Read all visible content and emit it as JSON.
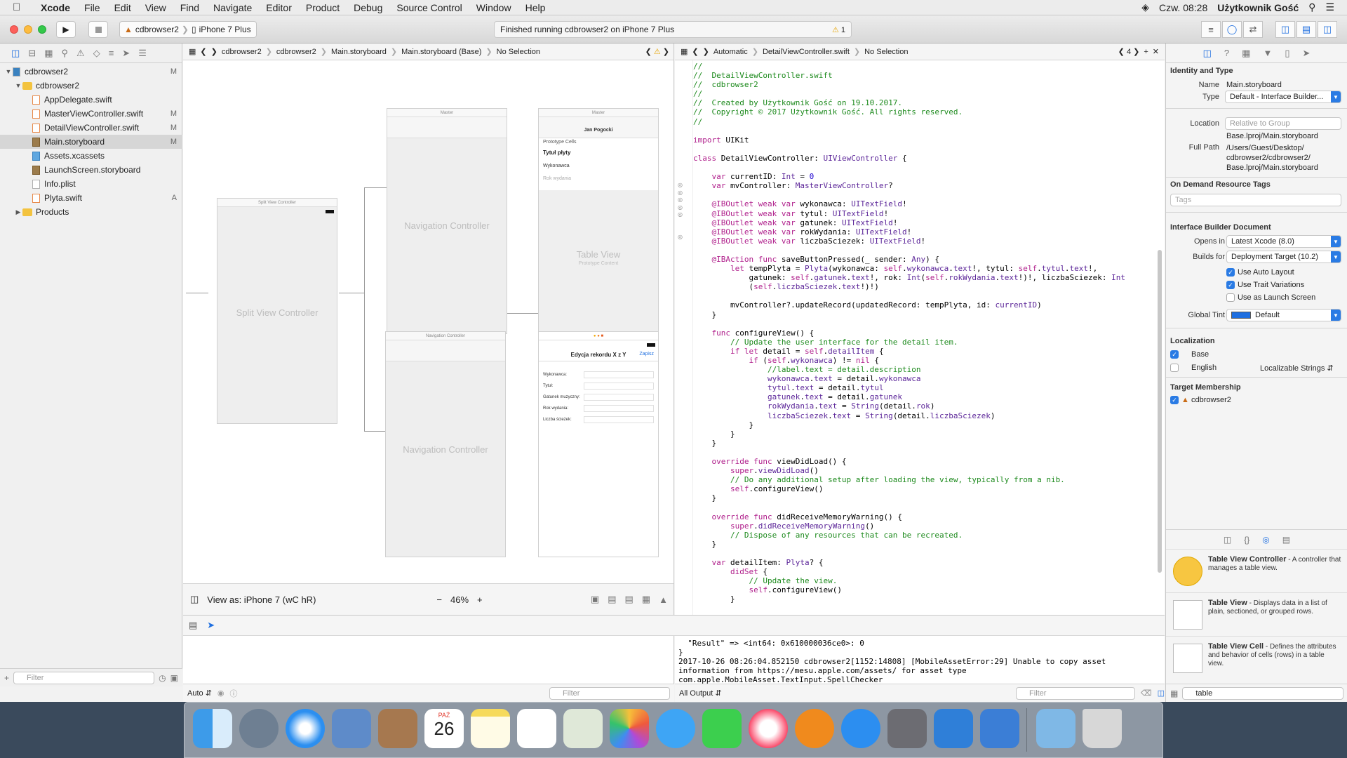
{
  "menubar": {
    "app": "Xcode",
    "items": [
      "File",
      "Edit",
      "View",
      "Find",
      "Navigate",
      "Editor",
      "Product",
      "Debug",
      "Source Control",
      "Window",
      "Help"
    ],
    "clock": "Czw. 08:28",
    "user": "Użytkownik Gość"
  },
  "toolbar": {
    "scheme": "cdbrowser2",
    "device": "iPhone 7 Plus",
    "activity": "Finished running cdbrowser2 on iPhone 7 Plus",
    "warnings": "1"
  },
  "navigator": {
    "rows": [
      {
        "label": "cdbrowser2",
        "badge": "M",
        "kind": "project",
        "indent": 0,
        "open": true
      },
      {
        "label": "cdbrowser2",
        "badge": "",
        "kind": "folder",
        "indent": 1,
        "open": true
      },
      {
        "label": "AppDelegate.swift",
        "badge": "",
        "kind": "swift",
        "indent": 2
      },
      {
        "label": "MasterViewController.swift",
        "badge": "M",
        "kind": "swift",
        "indent": 2
      },
      {
        "label": "DetailViewController.swift",
        "badge": "M",
        "kind": "swift",
        "indent": 2
      },
      {
        "label": "Main.storyboard",
        "badge": "M",
        "kind": "sb",
        "indent": 2,
        "selected": true
      },
      {
        "label": "Assets.xcassets",
        "badge": "",
        "kind": "xc",
        "indent": 2
      },
      {
        "label": "LaunchScreen.storyboard",
        "badge": "",
        "kind": "sb",
        "indent": 2
      },
      {
        "label": "Info.plist",
        "badge": "",
        "kind": "file",
        "indent": 2
      },
      {
        "label": "Plyta.swift",
        "badge": "A",
        "kind": "swift",
        "indent": 2
      },
      {
        "label": "Products",
        "badge": "",
        "kind": "folder",
        "indent": 1,
        "open": false
      }
    ],
    "filter_placeholder": "Filter"
  },
  "ib": {
    "jump": [
      "cdbrowser2",
      "cdbrowser2",
      "Main.storyboard",
      "Main.storyboard (Base)",
      "No Selection"
    ],
    "view_as": "View as: iPhone 7 (wC hR)",
    "zoom": "46%",
    "scenes": {
      "split": "Split View Controller",
      "split_bar": "Split View Controller",
      "nav1": "Navigation Controller",
      "nav1_bar": "Master",
      "table_bar": "Master",
      "table_title": "Jan Pogocki",
      "prototype": "Prototype Cells",
      "cell_title": "Tytuł płyty",
      "cell_sub1": "Wykonawca",
      "cell_sub2": "Rok wydania",
      "table_view": "Table View",
      "prototype_content": "Prototype Content",
      "nav2": "Navigation Controller",
      "nav2_bar": "Navigation Controller",
      "detail_title": "Edycja rekordu X z Y",
      "detail_save": "Zapisz",
      "fields": [
        "Wykonawca:",
        "Tytuł:",
        "Gatunek muzyczny:",
        "Rok wydania:",
        "Liczba ścieżek:"
      ]
    }
  },
  "code": {
    "jump": [
      "Automatic",
      "DetailViewController.swift",
      "No Selection"
    ],
    "counter": "4"
  },
  "debug": {
    "auto_label": "Auto",
    "filter_placeholder": "Filter",
    "output_label": "All Output",
    "console_filter": "Filter"
  },
  "inspector": {
    "identity_header": "Identity and Type",
    "name_label": "Name",
    "name_value": "Main.storyboard",
    "type_label": "Type",
    "type_value": "Default - Interface Builder...",
    "location_label": "Location",
    "location_value": "Relative to Group",
    "location_path": "Base.lproj/Main.storyboard",
    "fullpath_label": "Full Path",
    "fullpath_value": "/Users/Guest/Desktop/\ncdbrowser2/cdbrowser2/\nBase.lproj/Main.storyboard",
    "odr_header": "On Demand Resource Tags",
    "tags_placeholder": "Tags",
    "ibdoc_header": "Interface Builder Document",
    "opens_label": "Opens in",
    "opens_value": "Latest Xcode (8.0)",
    "builds_label": "Builds for",
    "builds_value": "Deployment Target (10.2)",
    "auto_layout": "Use Auto Layout",
    "trait_var": "Use Trait Variations",
    "launch_screen": "Use as Launch Screen",
    "tint_label": "Global Tint",
    "tint_value": "Default",
    "localization_header": "Localization",
    "loc_base": "Base",
    "loc_english": "English",
    "loc_strings": "Localizable Strings",
    "target_header": "Target Membership",
    "target_name": "cdbrowser2",
    "lib_filter": "table",
    "library": [
      {
        "title": "Table View Controller",
        "desc": " - A controller that manages a table view."
      },
      {
        "title": "Table View",
        "desc": " - Displays data in a list of plain, sectioned, or grouped rows."
      },
      {
        "title": "Table View Cell",
        "desc": " - Defines the attributes and behavior of cells (rows) in a table view."
      }
    ]
  },
  "dock": {
    "calendar_month": "PAŹ",
    "calendar_day": "26"
  }
}
